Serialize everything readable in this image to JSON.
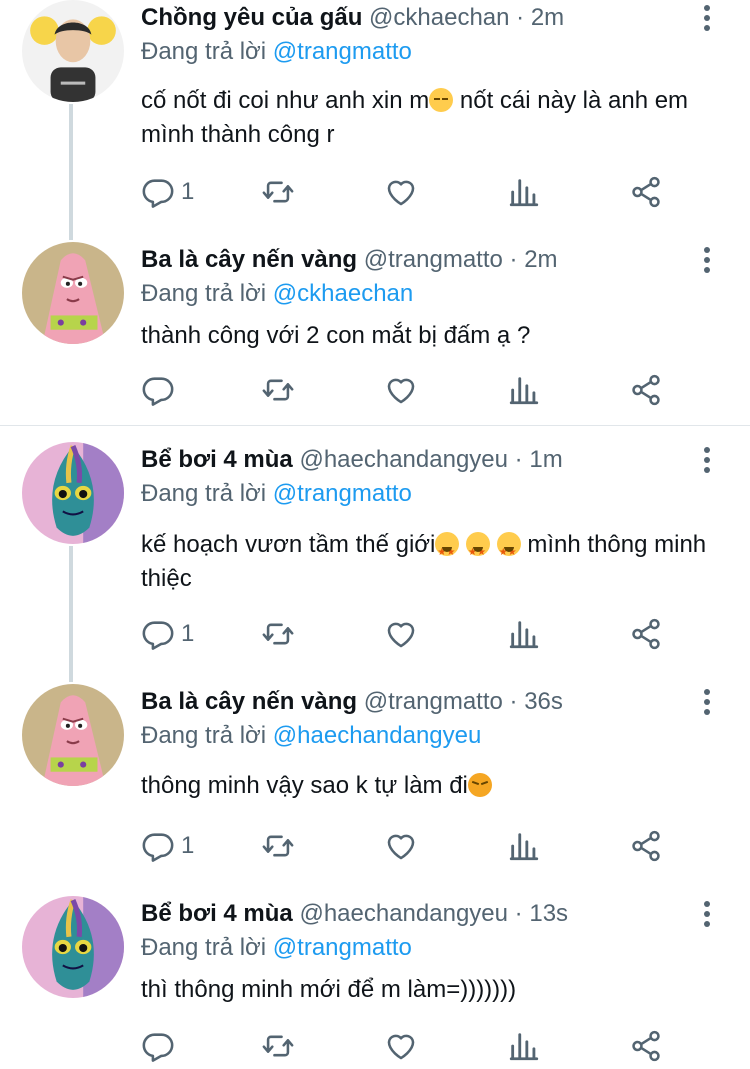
{
  "tweets": [
    {
      "name": "Chồng yêu của gấu",
      "handle": "@ckhaechan",
      "time": "2m",
      "reply_prefix": "Đang trả lời",
      "reply_to": "@trangmatto",
      "text_part1": "cố nốt đi coi như anh xin m",
      "text_part2": "  nốt cái này là anh em mình thành công r",
      "reply_count": "1",
      "avatar": "person-avatar-icon"
    },
    {
      "name": "Ba là cây nến vàng",
      "handle": "@trangmatto",
      "time": "2m",
      "reply_prefix": "Đang trả lời",
      "reply_to": "@ckhaechan",
      "text": "thành công với 2 con mắt bị đấm ạ ?",
      "reply_count": "",
      "avatar": "patrick-avatar-icon"
    },
    {
      "name": "Bể bơi 4 mùa",
      "handle": "@haechandangyeu",
      "time": "1m",
      "reply_prefix": "Đang trả lời",
      "reply_to": "@trangmatto",
      "text_part1": "kế hoạch vươn tầm thế giới",
      "text_part2": "  mình thông minh thiệc",
      "reply_count": "1",
      "avatar": "fish-avatar-icon"
    },
    {
      "name": "Ba là cây nến vàng",
      "handle": "@trangmatto",
      "time": "36s",
      "reply_prefix": "Đang trả lời",
      "reply_to": "@haechandangyeu",
      "text": "thông minh vậy sao k tự làm đi",
      "reply_count": "1",
      "avatar": "patrick-avatar-icon"
    },
    {
      "name": "Bể bơi 4 mùa",
      "handle": "@haechandangyeu",
      "time": "13s",
      "reply_prefix": "Đang trả lời",
      "reply_to": "@trangmatto",
      "text": "thì thông minh mới để m làm=)))))))",
      "reply_count": "",
      "avatar": "fish-avatar-icon"
    }
  ],
  "colors": {
    "link": "#1d9bf0",
    "secondary": "#536471",
    "text": "#0f1419"
  }
}
